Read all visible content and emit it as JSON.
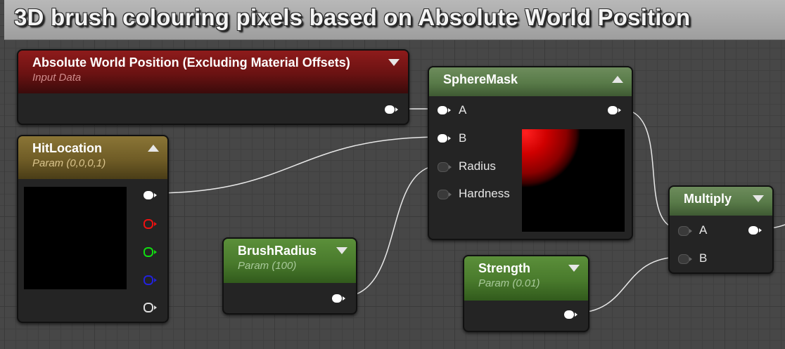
{
  "title": "3D brush colouring pixels based on Absolute World Position",
  "nodes": {
    "absolute_world_position": {
      "title": "Absolute World Position (Excluding Material Offsets)",
      "subtitle": "Input Data"
    },
    "hit_location": {
      "title": "HitLocation",
      "subtitle": "Param (0,0,0,1)"
    },
    "sphere_mask": {
      "title": "SphereMask",
      "inputs": [
        "A",
        "B",
        "Radius",
        "Hardness"
      ]
    },
    "brush_radius": {
      "title": "BrushRadius",
      "subtitle": "Param (100)"
    },
    "strength": {
      "title": "Strength",
      "subtitle": "Param (0.01)"
    },
    "multiply": {
      "title": "Multiply",
      "inputs": [
        "A",
        "B"
      ]
    }
  },
  "icons": {
    "collapse_down": "chevron-down-icon",
    "collapse_up": "chevron-up-icon"
  },
  "colors": {
    "input_header": "#8e1b1b",
    "param_header_gold": "#8a7536",
    "param_header_green": "#5b8f3a",
    "expression_header": "#587a48",
    "wire": "#e8e8e8"
  }
}
